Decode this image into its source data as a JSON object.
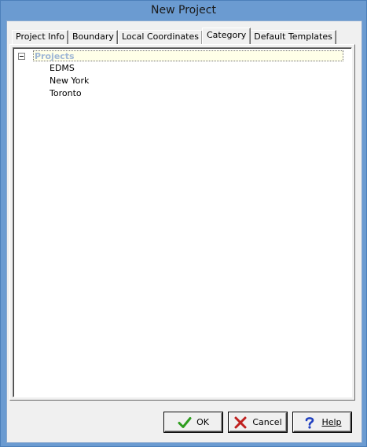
{
  "window": {
    "title": "New Project"
  },
  "tabs": [
    {
      "label": "Project Info",
      "active": false
    },
    {
      "label": "Boundary",
      "active": false
    },
    {
      "label": "Local Coordinates",
      "active": false
    },
    {
      "label": "Category",
      "active": true
    },
    {
      "label": "Default Templates",
      "active": false
    }
  ],
  "tree": {
    "root": {
      "label": "Projects",
      "expanded": true,
      "selected": true
    },
    "children": [
      "EDMS",
      "New York",
      "Toronto"
    ]
  },
  "buttons": {
    "ok": {
      "label": "OK",
      "icon": "checkmark-icon",
      "color": "#2e9e1f"
    },
    "cancel": {
      "label": "Cancel",
      "icon": "x-icon",
      "color": "#c0211f"
    },
    "help": {
      "label": "Help",
      "icon": "question-icon",
      "color": "#2040c0"
    }
  },
  "colors": {
    "title_bar": "#6b9bd1",
    "root_label_text": "#9fb7d6",
    "root_label_bg": "#ffffe8"
  }
}
